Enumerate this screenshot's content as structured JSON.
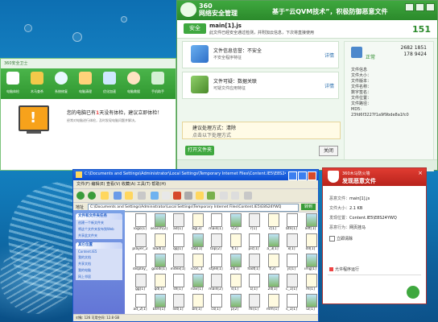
{
  "main360": {
    "title_logo": "360",
    "title_sub": "网络安全管理",
    "slogan": "基于“云QVM技术”，积极防御恶意文件",
    "safe_label": "安全",
    "file_name": "main[1].js",
    "status_sub": "此文件已经安全通过检测，并附加云信息，下次将直接使用",
    "count": "151",
    "items": [
      {
        "title": "文件信息信誉：不安全",
        "sub": "不安全程序特征",
        "more": "详情"
      },
      {
        "title": "文件可疑：数据关联",
        "sub": "可疑文件应用特征",
        "more": "详情"
      }
    ],
    "notice_line1": "建议处理方式：清除",
    "notice_line2": "点击以下处理方式",
    "open_label": "打开文件夹",
    "close_label": "关闭",
    "right_status": "正常",
    "right_num1": "2682 1851",
    "right_num2": "178 9424",
    "right_lines": [
      "文件信息",
      "文件大小：",
      "文件版本：",
      "文件名称：",
      "数字签名：",
      "文件位置：",
      "文件路径：",
      "MD5:",
      "23fd6f3227f1a9f9bde8a1fc0"
    ]
  },
  "green360": {
    "title": "360安全卫士",
    "tools": [
      "电脑体检",
      "木马查杀",
      "系统修复",
      "电脑清理",
      "优化加速",
      "电脑救援",
      "手机助手"
    ],
    "alert_prefix": "您的电脑已有",
    "alert_count": "1",
    "alert_suffix": "天没有体检，建议立即体检！",
    "alert_sub": "经常对电脑进行体检，及时发现电脑问题并解决。"
  },
  "explorer": {
    "title": "C:\\Documents and Settings\\Administrator\\Local Settings\\Temporary Internet Files\\Content.IE5\\E8S24YWQ",
    "menu": "文件(F)  编辑(E)  查看(V)  收藏(A)  工具(T)  帮助(H)",
    "address_label": "地址",
    "address": "C:\\Documents and Settings\\Administrator\\Local Settings\\Temporary Internet Files\\Content.IE5\\E8S24YWQ",
    "go_label": "转到",
    "side_panels": [
      {
        "header": "文件和文件夹任务",
        "links": [
          "创建一个新文件夹",
          "将这个文件夹发布到Web",
          "共享此文件夹"
        ]
      },
      {
        "header": "其它位置",
        "links": [
          "Content.IE5",
          "我的文档",
          "共享文档",
          "我的电脑",
          "网上邻居"
        ]
      }
    ],
    "files": [
      "logo[1]",
      "search[2]",
      "ad[1]",
      "bg[3]",
      "main[1]",
      "v[2]",
      "r[1]",
      "c[1]",
      "btn[1]",
      "left[1]",
      "player_2",
      "load[1]",
      "qq[1]",
      "tab[1]",
      "top[2]",
      "f[1]",
      "pic[1]",
      "a_3[1]",
      "x[1]",
      "dll[1]",
      "display_",
      "goodi[1]",
      "index[1]",
      "icon_1",
      "style[1]",
      "34[1]",
      "foot[1]",
      "t[2]",
      "js[1]",
      "img[1]",
      "gg[1]",
      "qd[1]",
      "sh[1]",
      "nav[1]",
      "main[2]",
      "s[1]",
      "1[1]",
      "24[1]",
      "c_1[1]",
      "m[1]",
      "ad_2[1]",
      "btm[1]",
      "list[1]",
      "bn[1]",
      "cs[1]",
      "p[2]",
      "mi[1]",
      "mm[1]",
      "s_1[1]",
      "ui[1]"
    ],
    "status": "对象: 126    可用空间: 12.8 GB"
  },
  "redwin": {
    "title_small": "360木马防火墙",
    "title": "发现恶意文件",
    "close": "×",
    "rows": [
      {
        "label": "恶意文件：",
        "value": "main[1].js"
      },
      {
        "label": "文件大小：",
        "value": "2.1 KB"
      },
      {
        "label": "发现位置：",
        "value": "Content.IE5\\E8S24YWQ"
      },
      {
        "label": "恶意行为：",
        "value": "网页挂马"
      }
    ],
    "check_label": "立即清除",
    "check_sub": "允许程序运行"
  }
}
